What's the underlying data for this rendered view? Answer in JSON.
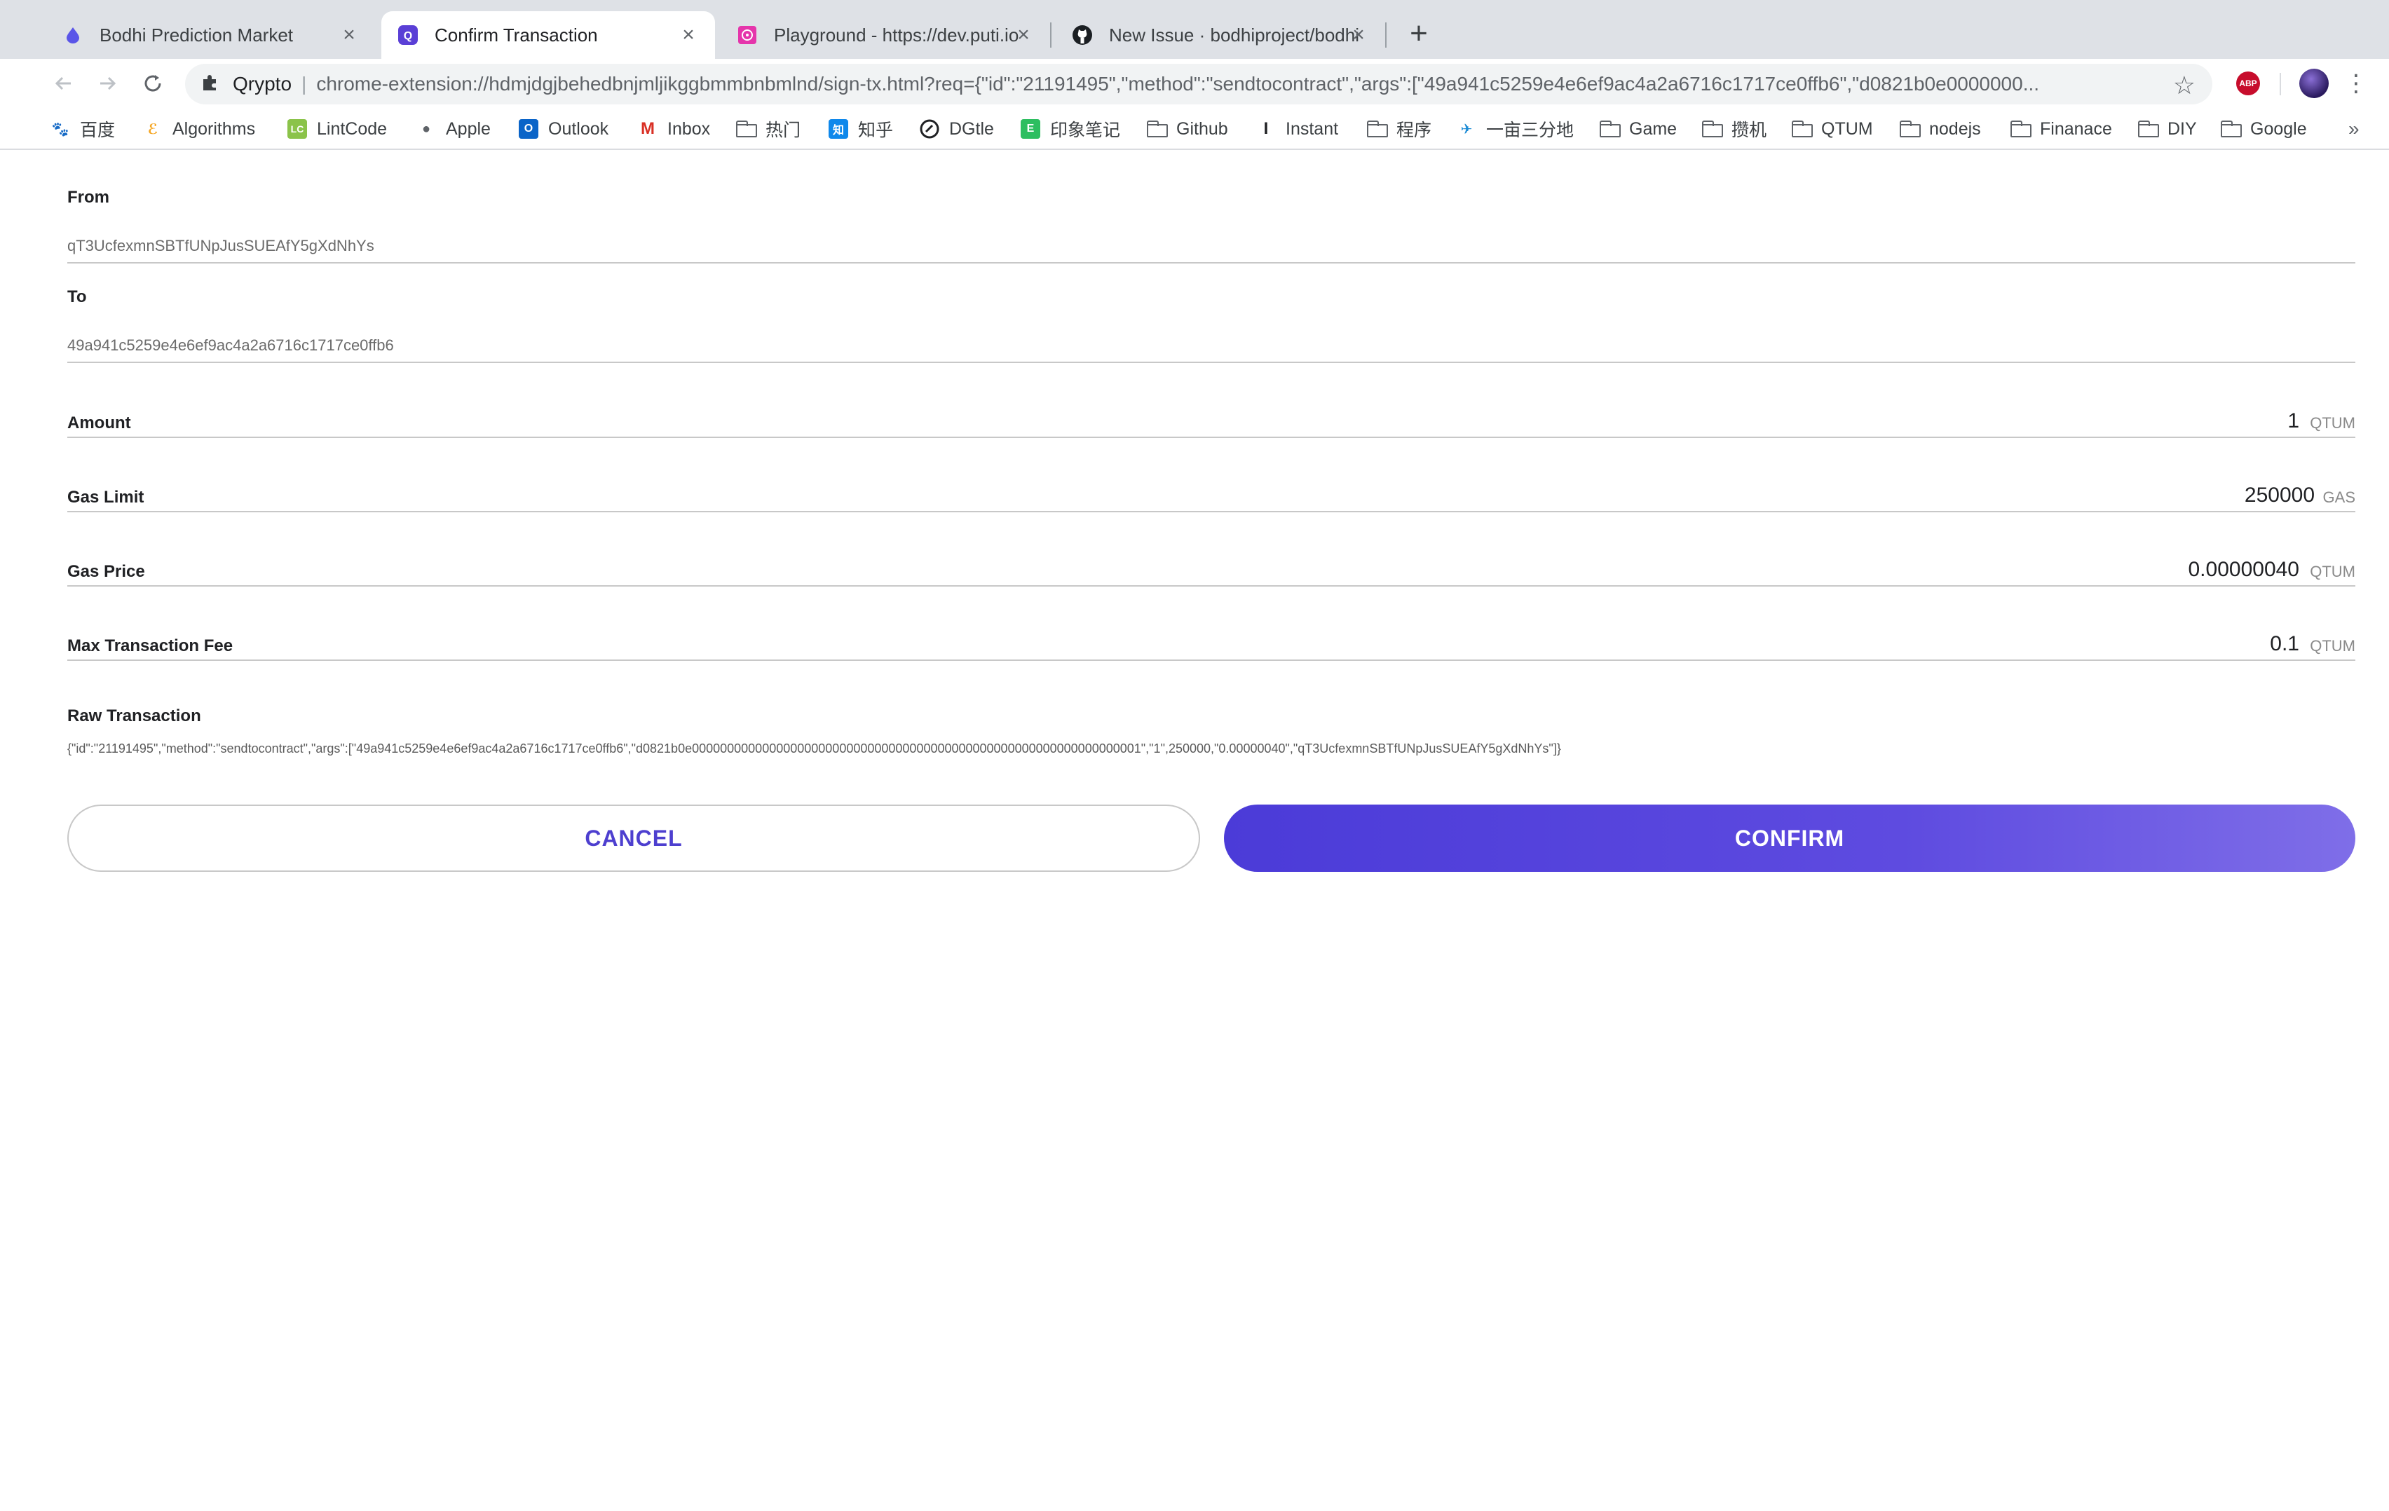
{
  "browser": {
    "tabs": [
      {
        "title": "Bodhi Prediction Market",
        "icon": "bodhi-drop-icon"
      },
      {
        "title": "Confirm Transaction",
        "icon": "qrypto-icon"
      },
      {
        "title": "Playground - https://dev.puti.io",
        "icon": "playground-icon"
      },
      {
        "title": "New Issue · bodhiproject/bodhi",
        "icon": "github-icon"
      }
    ],
    "omnibox": {
      "extension_name": "Qrypto",
      "url": "chrome-extension://hdmjdgjbehedbnjmljikggbmmbnbmlnd/sign-tx.html?req={\"id\":\"21191495\",\"method\":\"sendtocontract\",\"args\":[\"49a941c5259e4e6ef9ac4a2a6716c1717ce0ffb6\",\"d0821b0e0000000..."
    },
    "extensions": {
      "abp_label": "ABP"
    },
    "bookmarks": [
      "百度",
      "Algorithms",
      "LintCode",
      "Apple",
      "Outlook",
      "Inbox",
      "热门",
      "知乎",
      "DGtle",
      "印象笔记",
      "Github",
      "Instant",
      "程序",
      "一亩三分地",
      "Game",
      "攒机",
      "QTUM",
      "nodejs",
      "Finanace",
      "DIY",
      "Google"
    ],
    "bookmarks_more": "»"
  },
  "tx": {
    "from_label": "From",
    "from_value": "qT3UcfexmnSBTfUNpJusSUEAfY5gXdNhYs",
    "to_label": "To",
    "to_value": "49a941c5259e4e6ef9ac4a2a6716c1717ce0ffb6",
    "amount_label": "Amount",
    "amount_value": "1",
    "amount_unit": "QTUM",
    "gas_limit_label": "Gas Limit",
    "gas_limit_value": "250000",
    "gas_limit_unit": "GAS",
    "gas_price_label": "Gas Price",
    "gas_price_value": "0.00000040",
    "gas_price_unit": "QTUM",
    "max_fee_label": "Max Transaction Fee",
    "max_fee_value": "0.1",
    "max_fee_unit": "QTUM",
    "raw_label": "Raw Transaction",
    "raw_value": "{\"id\":\"21191495\",\"method\":\"sendtocontract\",\"args\":[\"49a941c5259e4e6ef9ac4a2a6716c1717ce0ffb6\",\"d0821b0e0000000000000000000000000000000000000000000000000000000000000001\",\"1\",250000,\"0.00000040\",\"qT3UcfexmnSBTfUNpJusSUEAfY5gXdNhYs\"]}"
  },
  "actions": {
    "cancel_label": "CANCEL",
    "confirm_label": "CONFIRM"
  },
  "colors": {
    "accent": "#4d3fcf",
    "confirm_gradient_start": "#4b3bd8",
    "confirm_gradient_end": "#7f6ee8"
  }
}
